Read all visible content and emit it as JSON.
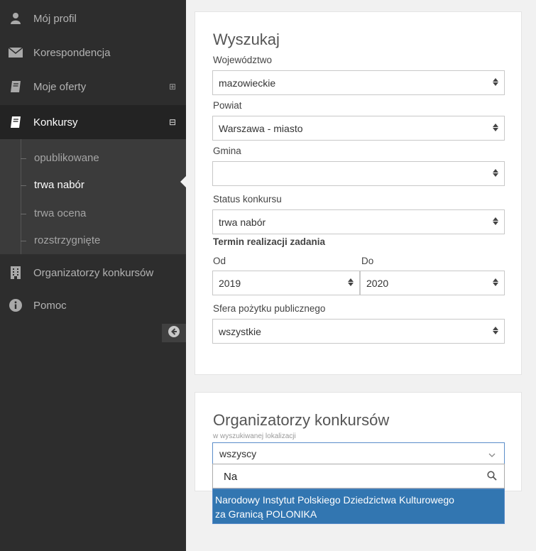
{
  "sidebar": {
    "items": [
      {
        "label": "Mój profil",
        "icon": "user-icon"
      },
      {
        "label": "Korespondencja",
        "icon": "envelope-icon"
      },
      {
        "label": "Moje oferty",
        "icon": "book-icon",
        "toggle": "⊞"
      },
      {
        "label": "Konkursy",
        "icon": "book-icon",
        "toggle": "⊟"
      },
      {
        "label": "Organizatorzy konkursów",
        "icon": "building-icon"
      },
      {
        "label": "Pomoc",
        "icon": "info-icon"
      }
    ],
    "submenu": [
      {
        "label": "opublikowane"
      },
      {
        "label": "trwa nabór"
      },
      {
        "label": "trwa ocena"
      },
      {
        "label": "rozstrzygnięte"
      }
    ],
    "collapse_icon": "arrow-left-circle-icon"
  },
  "search": {
    "title": "Wyszukaj",
    "wojewodztwo": {
      "label": "Województwo",
      "value": "mazowieckie"
    },
    "powiat": {
      "label": "Powiat",
      "value": "Warszawa - miasto"
    },
    "gmina": {
      "label": "Gmina",
      "value": ""
    },
    "status": {
      "label": "Status konkursu",
      "value": "trwa nabór"
    },
    "termin": {
      "label": "Termin realizacji zadania",
      "od_label": "Od",
      "od_value": "2019",
      "do_label": "Do",
      "do_value": "2020"
    },
    "sfera": {
      "label": "Sfera pożytku publicznego",
      "value": "wszystkie"
    }
  },
  "organizers": {
    "title": "Organizatorzy konkursów",
    "hint": "w wyszukiwanej lokalizacji",
    "selected": "wszyscy",
    "search_value": "Na",
    "result_line1": "Narodowy Instytut Polskiego Dziedzictwa Kulturowego",
    "result_line2": "za Granicą POLONIKA"
  },
  "colors": {
    "sidebar": "#2d2d2d",
    "highlight": "#3276b1"
  }
}
